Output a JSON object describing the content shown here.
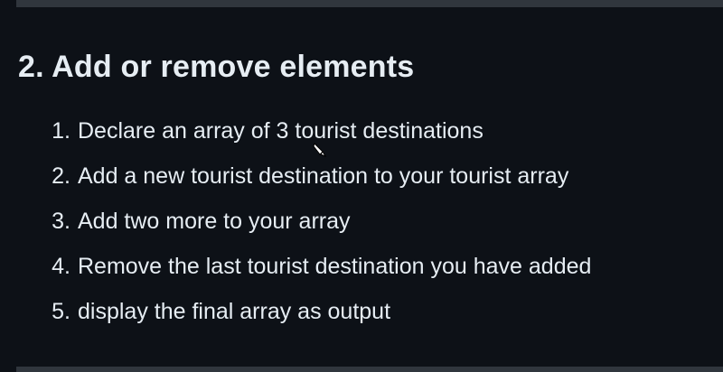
{
  "section": {
    "heading": "2. Add or remove elements"
  },
  "tasks": [
    {
      "num": "1.",
      "text": "Declare an array of 3 tourist destinations"
    },
    {
      "num": "2.",
      "text": "Add a new tourist destination to your tourist array"
    },
    {
      "num": "3.",
      "text": "Add two more to your array"
    },
    {
      "num": "4.",
      "text": "Remove the last tourist destination you have added"
    },
    {
      "num": "5.",
      "text": "display the final array as output"
    }
  ],
  "cursor": {
    "icon": "pen-cursor-icon"
  },
  "colors": {
    "background": "#0d1117",
    "text": "#e6edf3",
    "divider": "#30363d"
  }
}
